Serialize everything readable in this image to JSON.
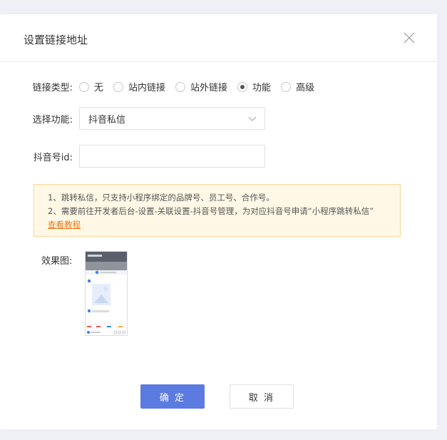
{
  "dialog": {
    "title": "设置链接地址"
  },
  "form": {
    "link_type": {
      "label": "链接类型:",
      "options": [
        "无",
        "站内链接",
        "站外链接",
        "功能",
        "高级"
      ],
      "selected": "功能"
    },
    "function": {
      "label": "选择功能:",
      "value": "抖音私信"
    },
    "douyin_id": {
      "label": "抖音号id:",
      "value": ""
    }
  },
  "notice": {
    "line1": "1、跳转私信，只支持小程序绑定的品牌号、员工号、合作号。",
    "line2": "2、需要前往开发者后台-设置-关联设置-抖音号管理，为对应抖音号申请“小程序跳转私信”",
    "link": "查看教程"
  },
  "preview": {
    "label": "效果图:"
  },
  "buttons": {
    "ok": "确 定",
    "cancel": "取 消"
  },
  "colors": {
    "primary": "#5b7be1",
    "notice_bg": "#fff8e6",
    "notice_border": "#f7d79a",
    "link": "#e87a1a"
  }
}
